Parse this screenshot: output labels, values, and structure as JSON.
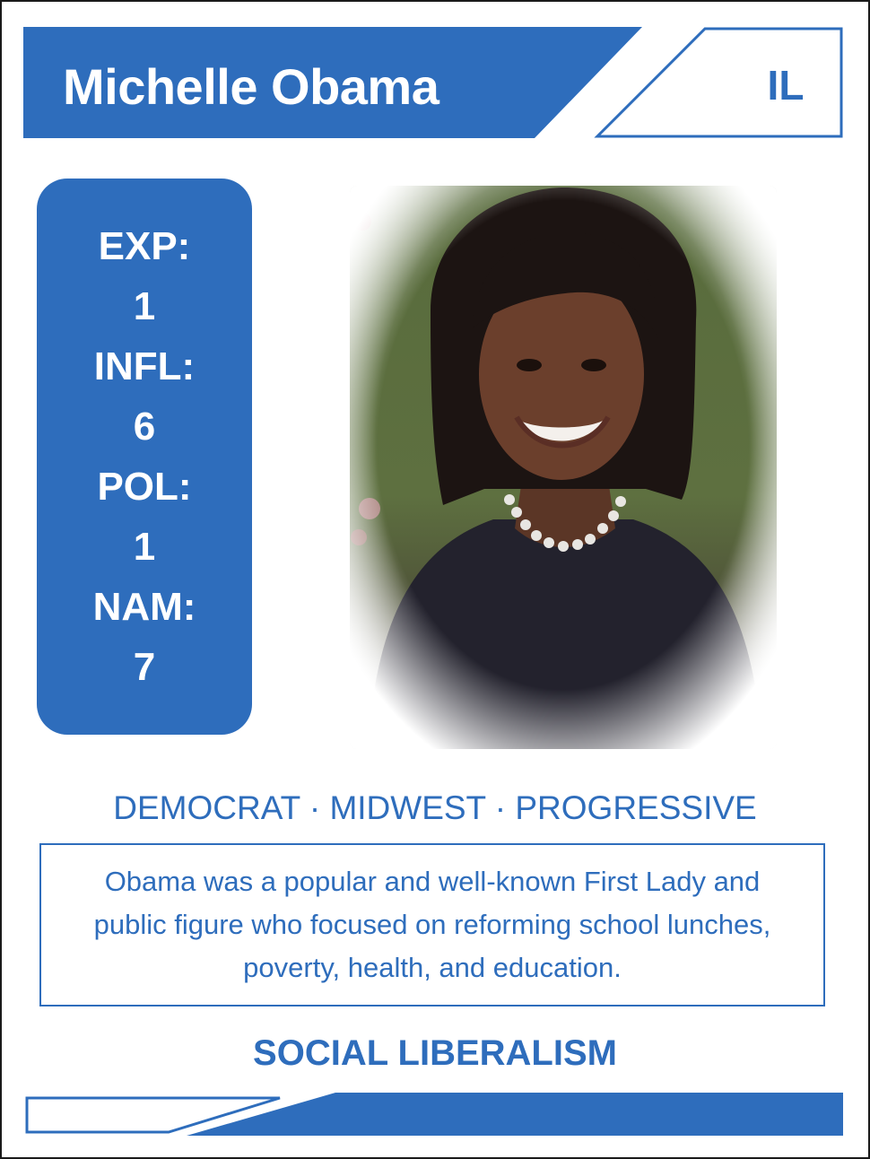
{
  "card": {
    "name": "Michelle Obama",
    "state": "IL",
    "stats": [
      {
        "label": "EXP:",
        "value": "1"
      },
      {
        "label": "INFL:",
        "value": "6"
      },
      {
        "label": "POL:",
        "value": "1"
      },
      {
        "label": "NAM:",
        "value": "7"
      }
    ],
    "tags": "DEMOCRAT · MIDWEST · PROGRESSIVE",
    "description": "Obama was a popular and well-known First Lady and public figure who focused on reforming school lunches, poverty, health, and education.",
    "ideology": "SOCIAL LIBERALISM"
  },
  "colors": {
    "accent": "#2e6dbc",
    "background": "#ffffff",
    "border": "#1a1a1a"
  },
  "portrait": {
    "icon": "portrait-photo"
  }
}
